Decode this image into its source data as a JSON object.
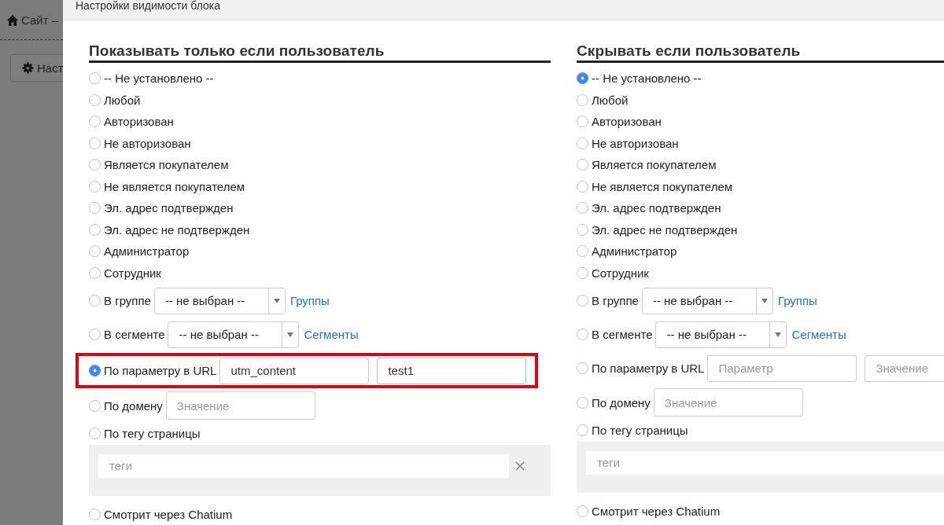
{
  "background": {
    "breadcrumb": "Сайт –",
    "button": "Наст"
  },
  "modal": {
    "title": "Настройки видимости блока"
  },
  "columns": [
    {
      "heading": "Показывать только если пользователь",
      "options": [
        {
          "kind": "plain",
          "label": "-- Не установлено --",
          "selected": false
        },
        {
          "kind": "plain",
          "label": "Любой",
          "selected": false
        },
        {
          "kind": "plain",
          "label": "Авторизован",
          "selected": false
        },
        {
          "kind": "plain",
          "label": "Не авторизован",
          "selected": false
        },
        {
          "kind": "plain",
          "label": "Является покупателем",
          "selected": false
        },
        {
          "kind": "plain",
          "label": "Не является покупателем",
          "selected": false
        },
        {
          "kind": "plain",
          "label": "Эл. адрес подтвержден",
          "selected": false
        },
        {
          "kind": "plain",
          "label": "Эл. адрес не подтвержден",
          "selected": false
        },
        {
          "kind": "plain",
          "label": "Администратор",
          "selected": false
        },
        {
          "kind": "plain",
          "label": "Сотрудник",
          "selected": false
        },
        {
          "kind": "select",
          "label": "В группе",
          "selected": false,
          "select_value": "-- не выбран --",
          "link": "Группы"
        },
        {
          "kind": "select",
          "label": "В сегменте",
          "selected": false,
          "select_value": "-- не выбран --",
          "link": "Сегменты"
        },
        {
          "kind": "url",
          "label": "По параметру в URL",
          "selected": true,
          "highlighted": true,
          "param": {
            "value": "utm_content"
          },
          "param_value": {
            "value": "test1"
          }
        },
        {
          "kind": "domain",
          "label": "По домену",
          "selected": false,
          "field": {
            "placeholder": "Значение"
          }
        },
        {
          "kind": "tags",
          "label": "По тегу страницы",
          "selected": false,
          "field": {
            "placeholder": "теги"
          },
          "clear_icon": true
        },
        {
          "kind": "plain",
          "label": "Смотрит через Chatium",
          "selected": false
        }
      ]
    },
    {
      "heading": "Скрывать если пользователь",
      "options": [
        {
          "kind": "plain",
          "label": "-- Не установлено --",
          "selected": true
        },
        {
          "kind": "plain",
          "label": "Любой",
          "selected": false
        },
        {
          "kind": "plain",
          "label": "Авторизован",
          "selected": false
        },
        {
          "kind": "plain",
          "label": "Не авторизован",
          "selected": false
        },
        {
          "kind": "plain",
          "label": "Является покупателем",
          "selected": false
        },
        {
          "kind": "plain",
          "label": "Не является покупателем",
          "selected": false
        },
        {
          "kind": "plain",
          "label": "Эл. адрес подтвержден",
          "selected": false
        },
        {
          "kind": "plain",
          "label": "Эл. адрес не подтвержден",
          "selected": false
        },
        {
          "kind": "plain",
          "label": "Администратор",
          "selected": false
        },
        {
          "kind": "plain",
          "label": "Сотрудник",
          "selected": false
        },
        {
          "kind": "select",
          "label": "В группе",
          "selected": false,
          "select_value": "-- не выбран --",
          "link": "Группы"
        },
        {
          "kind": "select",
          "label": "В сегменте",
          "selected": false,
          "select_value": "-- не выбран --",
          "link": "Сегменты"
        },
        {
          "kind": "url",
          "label": "По параметру в URL",
          "selected": false,
          "highlighted": false,
          "param": {
            "placeholder": "Параметр"
          },
          "param_value": {
            "placeholder": "Значение"
          }
        },
        {
          "kind": "domain",
          "label": "По домену",
          "selected": false,
          "field": {
            "placeholder": "Значение"
          }
        },
        {
          "kind": "tags",
          "label": "По тегу страницы",
          "selected": false,
          "field": {
            "placeholder": "теги"
          }
        },
        {
          "kind": "plain",
          "label": "Смотрит через Chatium",
          "selected": false
        }
      ]
    }
  ]
}
